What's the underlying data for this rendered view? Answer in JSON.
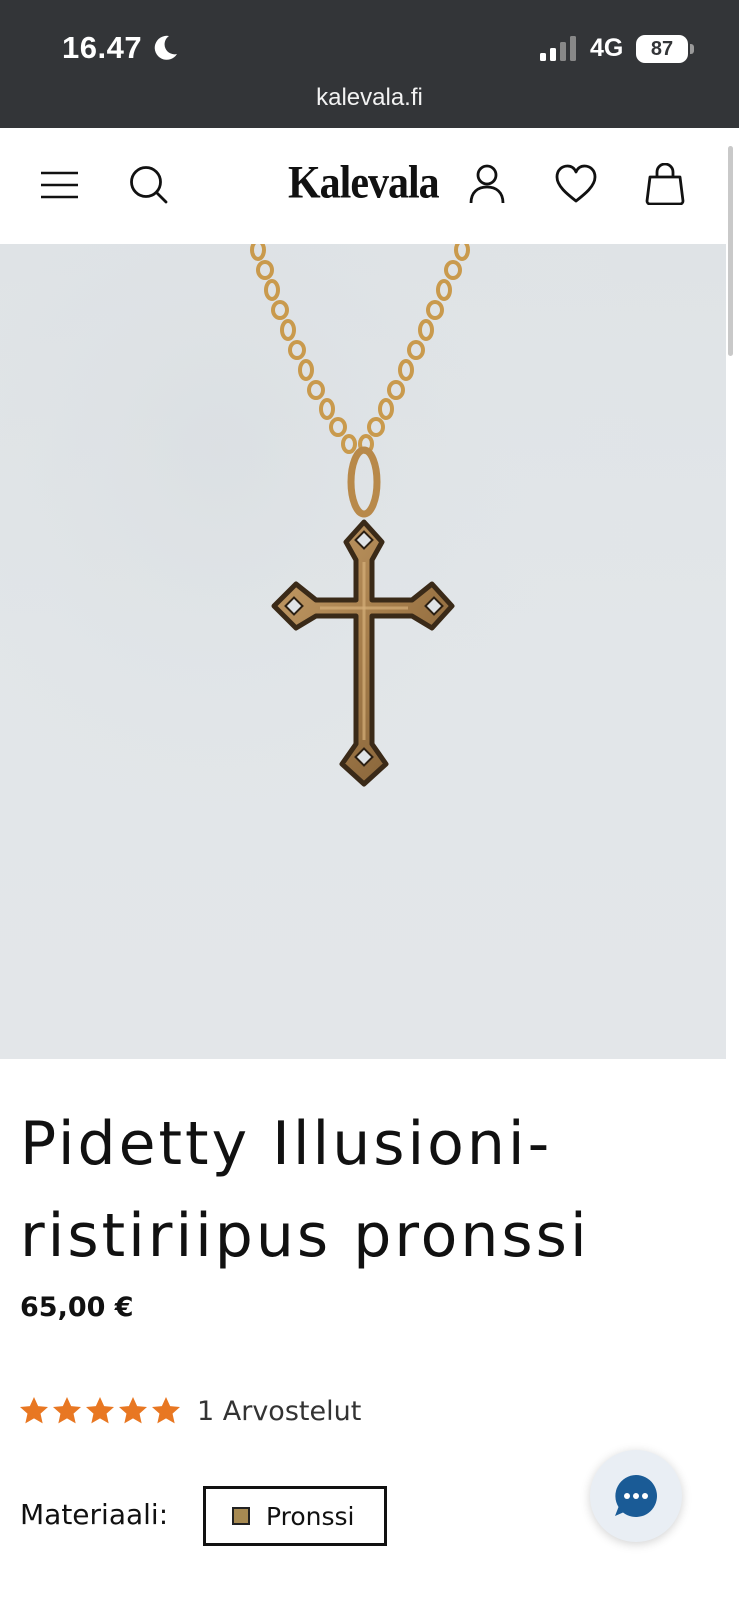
{
  "status_bar": {
    "time": "16.47",
    "network": "4G",
    "battery": "87"
  },
  "browser": {
    "url": "kalevala.fi"
  },
  "header": {
    "logo": "Kalevala",
    "icons": [
      "menu-icon",
      "search-icon",
      "account-icon",
      "heart-icon",
      "bag-icon"
    ]
  },
  "product": {
    "title": "Pidetty Illusioni-ristiriipus pronssi",
    "price": "65,00 €",
    "rating": {
      "stars": 5,
      "max_stars": 5,
      "review_text": "1 Arvostelut",
      "star_color": "#e87722"
    },
    "material": {
      "label": "Materiaali:",
      "selected": "Pronssi",
      "swatch_color": "#a78a52"
    }
  },
  "chat": {
    "icon": "chat-bubble-icon",
    "color": "#1a5b96"
  }
}
